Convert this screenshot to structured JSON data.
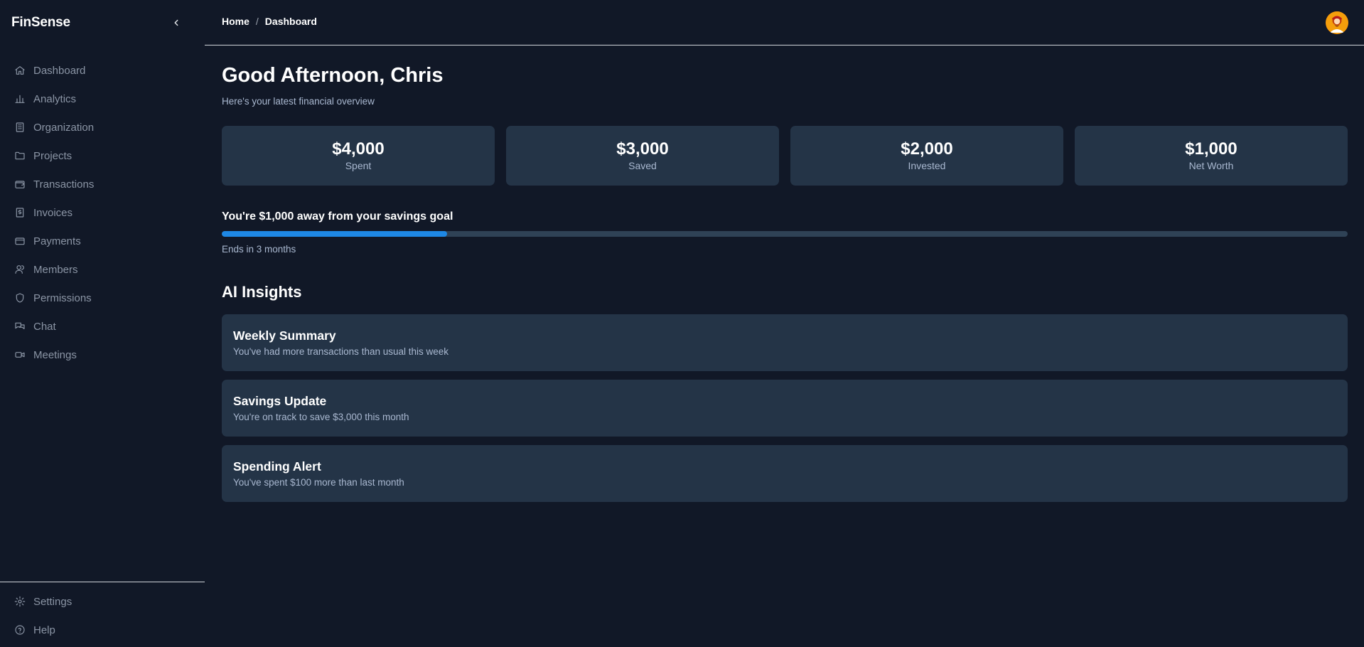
{
  "app": {
    "brand": "FinSense"
  },
  "header": {
    "breadcrumb": {
      "home": "Home",
      "separator": "/",
      "current": "Dashboard"
    }
  },
  "sidebar": {
    "items": [
      {
        "label": "Dashboard",
        "icon": "home-icon"
      },
      {
        "label": "Analytics",
        "icon": "bar-chart-icon"
      },
      {
        "label": "Organization",
        "icon": "building-icon"
      },
      {
        "label": "Projects",
        "icon": "folder-icon"
      },
      {
        "label": "Transactions",
        "icon": "wallet-icon"
      },
      {
        "label": "Invoices",
        "icon": "receipt-icon"
      },
      {
        "label": "Payments",
        "icon": "credit-card-icon"
      },
      {
        "label": "Members",
        "icon": "users-icon"
      },
      {
        "label": "Permissions",
        "icon": "shield-icon"
      },
      {
        "label": "Chat",
        "icon": "chat-icon"
      },
      {
        "label": "Meetings",
        "icon": "video-icon"
      }
    ],
    "bottom_items": [
      {
        "label": "Settings",
        "icon": "gear-icon"
      },
      {
        "label": "Help",
        "icon": "help-circle-icon"
      }
    ]
  },
  "main": {
    "greeting": "Good Afternoon, Chris",
    "subtitle": "Here's your latest financial overview",
    "stats": [
      {
        "value": "$4,000",
        "label": "Spent"
      },
      {
        "value": "$3,000",
        "label": "Saved"
      },
      {
        "value": "$2,000",
        "label": "Invested"
      },
      {
        "value": "$1,000",
        "label": "Net Worth"
      }
    ],
    "goal": {
      "title": "You're $1,000 away from your savings goal",
      "progress_percent": 20,
      "ends": "Ends in 3 months"
    },
    "insights_title": "AI Insights",
    "insights": [
      {
        "title": "Weekly Summary",
        "description": "You've had more transactions than usual this week"
      },
      {
        "title": "Savings Update",
        "description": "You're on track to save $3,000 this month"
      },
      {
        "title": "Spending Alert",
        "description": "You've spent $100 more than last month"
      }
    ]
  },
  "colors": {
    "background": "#111827",
    "card": "#243447",
    "accent": "#1e88e5",
    "muted_text": "#a9b8d0",
    "nav_text": "#8b95a5"
  }
}
